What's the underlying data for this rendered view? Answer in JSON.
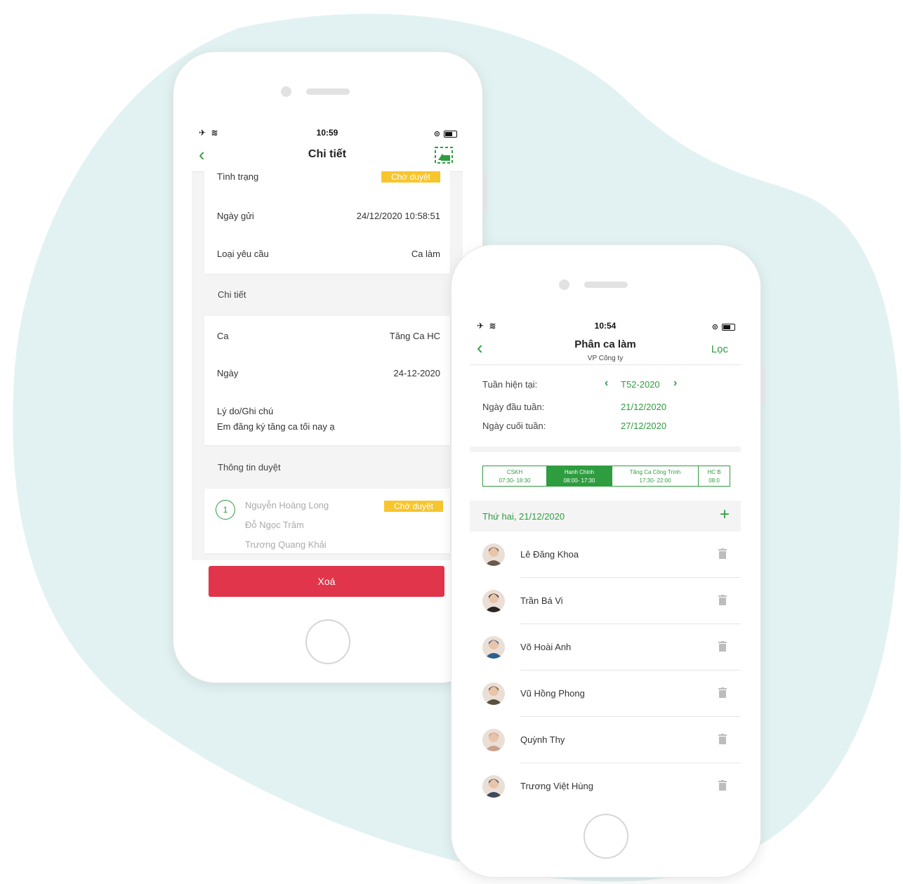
{
  "detail_screen": {
    "status_time": "10:59",
    "title": "Chi tiết",
    "info": {
      "status_label": "Tình trạng",
      "status_value": "Chờ duyệt",
      "sent_label": "Ngày gửi",
      "sent_value": "24/12/2020 10:58:51",
      "type_label": "Loại yêu cầu",
      "type_value": "Ca làm"
    },
    "detail_section": "Chi tiết",
    "detail": {
      "shift_label": "Ca",
      "shift_value": "Tăng Ca HC",
      "date_label": "Ngày",
      "date_value": "24-12-2020",
      "reason_label": "Lý do/Ghi chú",
      "reason_value": "Em đăng ký tăng ca tối nay ạ"
    },
    "approval_section": "Thông tin duyệt",
    "approval": {
      "step_number": "1",
      "approvers": [
        "Nguyễn Hoàng Long",
        "Đỗ Ngọc Trâm",
        "Trương Quang Khải"
      ],
      "status": "Chờ duyệt"
    },
    "delete_button": "Xoá"
  },
  "shift_screen": {
    "status_time": "10:54",
    "title": "Phân ca làm",
    "subtitle": "VP Công ty",
    "filter_button": "Lọc",
    "week": {
      "current_label": "Tuần hiện tại:",
      "current_value": "T52-2020",
      "start_label": "Ngày đầu tuần:",
      "start_value": "21/12/2020",
      "end_label": "Ngày cuối tuần:",
      "end_value": "27/12/2020"
    },
    "shifts": [
      {
        "name": "CSKH",
        "time": "07:30- 18:30",
        "active": false
      },
      {
        "name": "Hanh Chinh",
        "time": "08:00- 17:30",
        "active": true
      },
      {
        "name": "Tăng Ca Công Trình",
        "time": "17:30- 22:00",
        "active": false
      },
      {
        "name": "HC B",
        "time": "08:0",
        "active": false
      }
    ],
    "day_label": "Thứ hai, 21/12/2020",
    "employees": [
      {
        "name": "Lê Đăng Khoa",
        "color": "#6b5a4a"
      },
      {
        "name": "Trần Bá Vi",
        "color": "#2b2424"
      },
      {
        "name": "Võ Hoài Anh",
        "color": "#2f5f8f"
      },
      {
        "name": "Vũ Hồng Phong",
        "color": "#5a5040"
      },
      {
        "name": "Quỳnh Thy",
        "color": "#c9a08a"
      },
      {
        "name": "Trương Việt Hùng",
        "color": "#3e4a5c"
      }
    ]
  },
  "colors": {
    "accent_green": "#2e9d3f",
    "pending_yellow": "#f7c52d",
    "delete_red": "#e0354a",
    "background_blob": "#e2f2f3"
  }
}
